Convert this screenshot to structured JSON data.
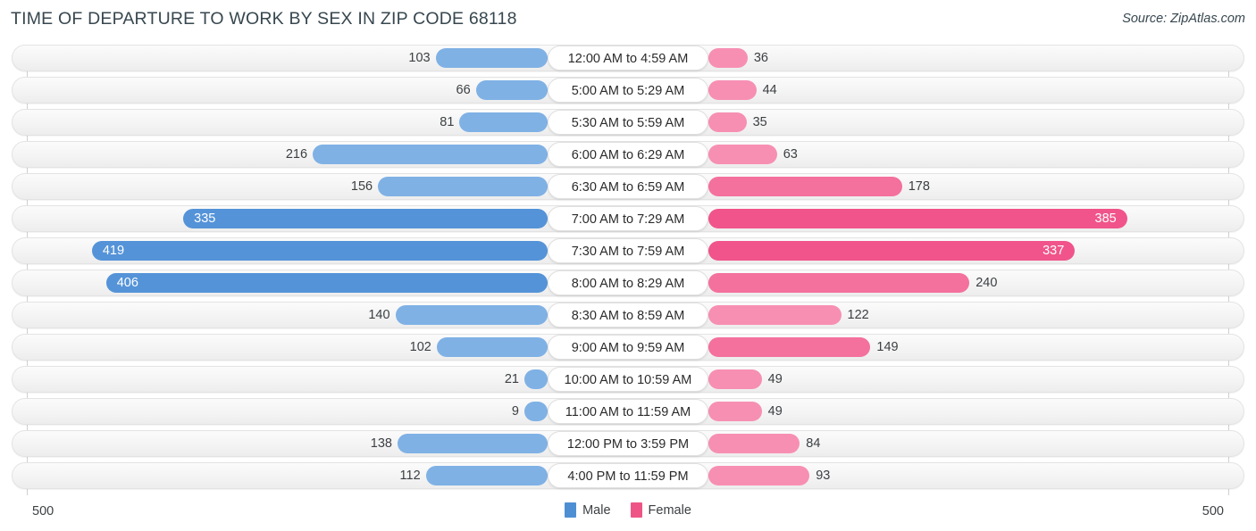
{
  "header": {
    "title": "TIME OF DEPARTURE TO WORK BY SEX IN ZIP CODE 68118",
    "source": "Source: ZipAtlas.com"
  },
  "legend": {
    "male_label": "Male",
    "female_label": "Female",
    "male_color": "#4e8fd4",
    "female_color": "#ee5586"
  },
  "axis": {
    "left_label": "500",
    "right_label": "500"
  },
  "chart_data": {
    "type": "bar",
    "title": "TIME OF DEPARTURE TO WORK BY SEX IN ZIP CODE 68118",
    "subtitle": "Source: ZipAtlas.com",
    "orientation": "horizontal-diverging",
    "xlabel": "",
    "ylabel": "",
    "xlim": [
      500,
      500
    ],
    "axis_left_max": 500,
    "axis_right_max": 500,
    "grid": false,
    "legend_position": "bottom-center",
    "categories": [
      "12:00 AM to 4:59 AM",
      "5:00 AM to 5:29 AM",
      "5:30 AM to 5:59 AM",
      "6:00 AM to 6:29 AM",
      "6:30 AM to 6:59 AM",
      "7:00 AM to 7:29 AM",
      "7:30 AM to 7:59 AM",
      "8:00 AM to 8:29 AM",
      "8:30 AM to 8:59 AM",
      "9:00 AM to 9:59 AM",
      "10:00 AM to 10:59 AM",
      "11:00 AM to 11:59 AM",
      "12:00 PM to 3:59 PM",
      "4:00 PM to 11:59 PM"
    ],
    "series": [
      {
        "name": "Male",
        "color": "#4e8fd4",
        "values": [
          103,
          66,
          81,
          216,
          156,
          335,
          419,
          406,
          140,
          102,
          21,
          9,
          138,
          112
        ]
      },
      {
        "name": "Female",
        "color": "#ee5586",
        "values": [
          36,
          44,
          35,
          63,
          178,
          385,
          337,
          240,
          122,
          149,
          49,
          49,
          84,
          93
        ]
      }
    ]
  },
  "rows": [
    {
      "label": "12:00 AM to 4:59 AM",
      "male": 103,
      "female": 36,
      "male_tone": "light",
      "female_tone": "light",
      "male_inside": false,
      "female_inside": false
    },
    {
      "label": "5:00 AM to 5:29 AM",
      "male": 66,
      "female": 44,
      "male_tone": "light",
      "female_tone": "light",
      "male_inside": false,
      "female_inside": false
    },
    {
      "label": "5:30 AM to 5:59 AM",
      "male": 81,
      "female": 35,
      "male_tone": "light",
      "female_tone": "light",
      "male_inside": false,
      "female_inside": false
    },
    {
      "label": "6:00 AM to 6:29 AM",
      "male": 216,
      "female": 63,
      "male_tone": "light",
      "female_tone": "light",
      "male_inside": false,
      "female_inside": false
    },
    {
      "label": "6:30 AM to 6:59 AM",
      "male": 156,
      "female": 178,
      "male_tone": "light",
      "female_tone": "mid",
      "male_inside": false,
      "female_inside": false
    },
    {
      "label": "7:00 AM to 7:29 AM",
      "male": 335,
      "female": 385,
      "male_tone": "hi",
      "female_tone": "hi",
      "male_inside": true,
      "female_inside": true
    },
    {
      "label": "7:30 AM to 7:59 AM",
      "male": 419,
      "female": 337,
      "male_tone": "hi",
      "female_tone": "hi",
      "male_inside": true,
      "female_inside": true
    },
    {
      "label": "8:00 AM to 8:29 AM",
      "male": 406,
      "female": 240,
      "male_tone": "hi",
      "female_tone": "mid",
      "male_inside": true,
      "female_inside": false
    },
    {
      "label": "8:30 AM to 8:59 AM",
      "male": 140,
      "female": 122,
      "male_tone": "light",
      "female_tone": "light",
      "male_inside": false,
      "female_inside": false
    },
    {
      "label": "9:00 AM to 9:59 AM",
      "male": 102,
      "female": 149,
      "male_tone": "light",
      "female_tone": "mid",
      "male_inside": false,
      "female_inside": false
    },
    {
      "label": "10:00 AM to 10:59 AM",
      "male": 21,
      "female": 49,
      "male_tone": "light",
      "female_tone": "light",
      "male_inside": false,
      "female_inside": false
    },
    {
      "label": "11:00 AM to 11:59 AM",
      "male": 9,
      "female": 49,
      "male_tone": "light",
      "female_tone": "light",
      "male_inside": false,
      "female_inside": false
    },
    {
      "label": "12:00 PM to 3:59 PM",
      "male": 138,
      "female": 84,
      "male_tone": "light",
      "female_tone": "light",
      "male_inside": false,
      "female_inside": false
    },
    {
      "label": "4:00 PM to 11:59 PM",
      "male": 112,
      "female": 93,
      "male_tone": "light",
      "female_tone": "light",
      "male_inside": false,
      "female_inside": false
    }
  ]
}
